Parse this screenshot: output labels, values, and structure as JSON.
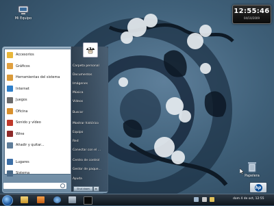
{
  "desktop": {
    "computer_icon_label": "Mi Equipo",
    "trash_icon_label": "Papelera",
    "clock": {
      "time": "12:55:46",
      "date": "04/10/2009"
    }
  },
  "start_menu": {
    "left_items": [
      {
        "label": "Accesorios",
        "icon": "folder-icon",
        "color": "#e8b73a"
      },
      {
        "label": "Gráficos",
        "icon": "graphics-icon",
        "color": "#e0a040"
      },
      {
        "label": "Herramientas del sistema",
        "icon": "tools-icon",
        "color": "#d99a3a"
      },
      {
        "label": "Internet",
        "icon": "globe-icon",
        "color": "#2f7fc9"
      },
      {
        "label": "Juegos",
        "icon": "games-icon",
        "color": "#6b6b6b"
      },
      {
        "label": "Oficina",
        "icon": "office-icon",
        "color": "#d8902d"
      },
      {
        "label": "Sonido y vídeo",
        "icon": "media-icon",
        "color": "#c0392b"
      },
      {
        "label": "Wine",
        "icon": "wine-icon",
        "color": "#8e2a2a"
      },
      {
        "label": "Añadir y quitar...",
        "icon": "package-icon",
        "color": "#5e7d99"
      },
      {
        "label": "Lugares",
        "icon": "places-icon",
        "color": "#3d6fa6"
      },
      {
        "label": "Sistema",
        "icon": "system-icon",
        "color": "#4a6a88"
      }
    ],
    "search_placeholder": "",
    "right_items": [
      "Carpeta personal",
      "Documentos",
      "Imágenes",
      "Música",
      "Vídeos",
      "Buscar",
      "Mostrar histórico",
      "Equipo",
      "Red",
      "Conectar con el ...",
      "Centro de control",
      "Gestor de paque...",
      "Ayuda"
    ],
    "shutdown_label": "Shut down",
    "shutdown_arrow": "▸"
  },
  "taskbar": {
    "tray_datetime": "dom  4 de oct, 12:55"
  }
}
